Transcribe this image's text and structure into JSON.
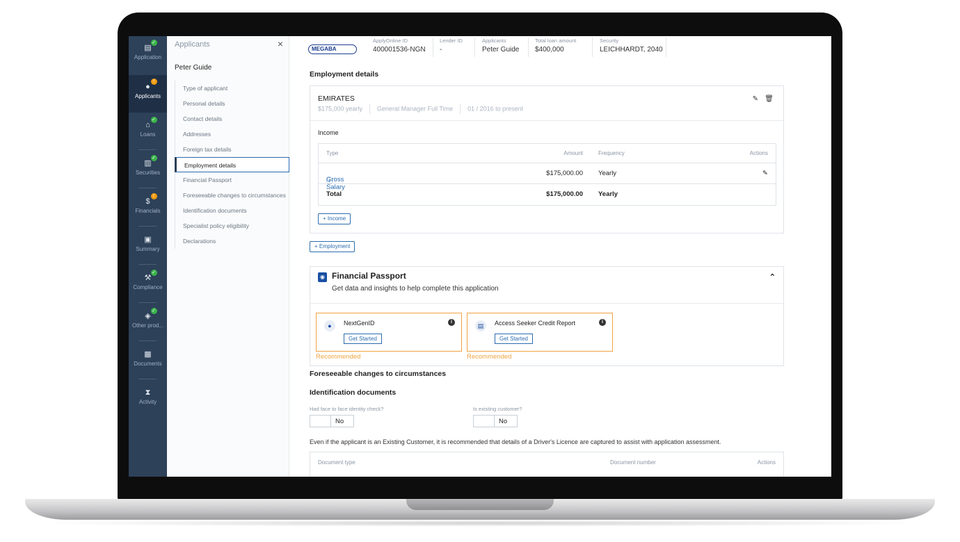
{
  "rail": {
    "items": [
      {
        "label": "Application",
        "icon": "document-icon",
        "status": "ok"
      },
      {
        "label": "Applicants",
        "icon": "person-icon",
        "status": "warn"
      },
      {
        "label": "Loans",
        "icon": "bank-icon",
        "status": "ok"
      },
      {
        "label": "Securities",
        "icon": "building-icon",
        "status": "ok"
      },
      {
        "label": "Financials",
        "icon": "dollar-icon",
        "status": "warn"
      },
      {
        "label": "Summary",
        "icon": "id-card-icon",
        "status": ""
      },
      {
        "label": "Compliance",
        "icon": "gavel-icon",
        "status": "ok"
      },
      {
        "label": "Other prod...",
        "icon": "box-icon",
        "status": "ok"
      },
      {
        "label": "Documents",
        "icon": "file-icon",
        "status": ""
      },
      {
        "label": "Activity",
        "icon": "hourglass-icon",
        "status": ""
      }
    ]
  },
  "panel": {
    "title": "Applicants",
    "close": "×",
    "applicant_name": "Peter Guide",
    "items": [
      "Type of applicant",
      "Personal details",
      "Contact details",
      "Addresses",
      "Foreign tax details",
      "Employment details",
      "Financial Passport",
      "Foreseeable changes to circumstances",
      "Identification documents",
      "Specialist policy eligibility",
      "Declarations"
    ]
  },
  "topbar": {
    "logo": "MEGABA",
    "applyonline_label": "ApplyOnline ID",
    "applyonline_value": "400001536-NGN",
    "lender_label": "Lender ID",
    "lender_value": "-",
    "applicants_label": "Applicants",
    "applicants_value": "Peter Guide",
    "loan_label": "Total loan amount",
    "loan_value": "$400,000",
    "security_label": "Security",
    "security_value": "LEICHHARDT, 2040"
  },
  "employment": {
    "heading": "Employment details",
    "employer": "EMIRATES",
    "salary": "$175,000 yearly",
    "role": "General Manager Full Time",
    "period": "01 / 2016 to present",
    "income_label": "Income",
    "columns": {
      "type": "Type",
      "amount": "Amount",
      "frequency": "Frequency",
      "actions": "Actions"
    },
    "rows": [
      {
        "type": "Gross Salary",
        "amount": "$175,000.00",
        "frequency": "Yearly"
      }
    ],
    "total": {
      "label": "Total",
      "amount": "$175,000.00",
      "frequency": "Yearly"
    },
    "add_income": "+ Income",
    "add_employment": "+ Employment"
  },
  "passport": {
    "title": "Financial Passport",
    "subtitle": "Get data and insights to help complete this application",
    "providers": [
      {
        "name": "NextGenID",
        "button": "Get Started",
        "tag": "Recommended"
      },
      {
        "name": "Access Seeker Credit Report",
        "button": "Get Started",
        "tag": "Recommended"
      }
    ]
  },
  "foreseeable_heading": "Foreseeable changes to circumstances",
  "identification": {
    "heading": "Identification documents",
    "face_check_label": "Had face to face identity check?",
    "face_check_value": "No",
    "existing_label": "Is existing customer?",
    "existing_value": "No",
    "note": "Even if the applicant is an Existing Customer, it is recommended that details of a Driver's Licence are captured to assist with application assessment.",
    "columns": {
      "type": "Document type",
      "number": "Document number",
      "actions": "Actions"
    }
  },
  "colors": {
    "rail": "#2d4159",
    "accent": "#2b6cb0",
    "recommended": "#f0a340",
    "ok": "#3bb54a",
    "warn": "#f39c12"
  }
}
